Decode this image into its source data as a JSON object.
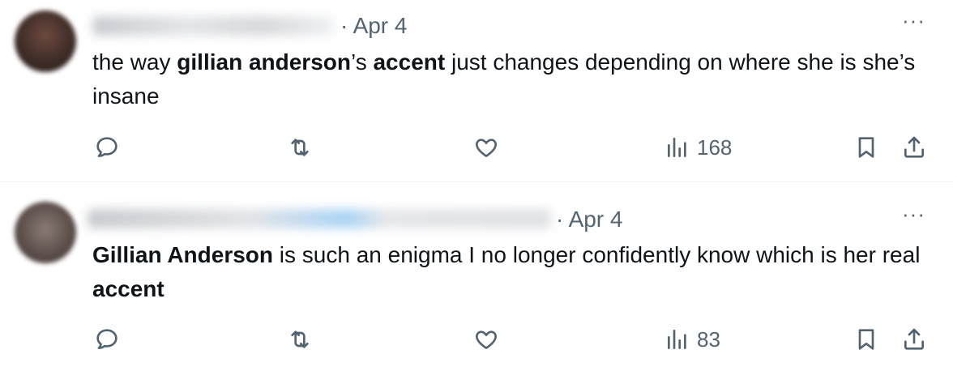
{
  "tweets": [
    {
      "author_name": "",
      "separator": "·",
      "date": "Apr 4",
      "more_label": "···",
      "text_parts": [
        {
          "t": "the way ",
          "bold": false
        },
        {
          "t": "gillian anderson",
          "bold": true
        },
        {
          "t": "’s ",
          "bold": false
        },
        {
          "t": "accent",
          "bold": true
        },
        {
          "t": " just changes depending on where she is she’s insane",
          "bold": false
        }
      ],
      "views_count": "168"
    },
    {
      "author_name": "",
      "separator": "·",
      "date": "Apr 4",
      "more_label": "···",
      "text_parts": [
        {
          "t": "Gillian Anderson",
          "bold": true
        },
        {
          "t": " is such an enigma I no longer confidently know which is her real ",
          "bold": false
        },
        {
          "t": "accent",
          "bold": true
        }
      ],
      "views_count": "83"
    }
  ],
  "icons": {
    "reply": "reply-icon",
    "retweet": "retweet-icon",
    "like": "like-icon",
    "views": "views-icon",
    "bookmark": "bookmark-icon",
    "share": "share-icon"
  },
  "colors": {
    "text": "#0f1419",
    "secondary": "#536471",
    "divider": "#eff3f4"
  }
}
